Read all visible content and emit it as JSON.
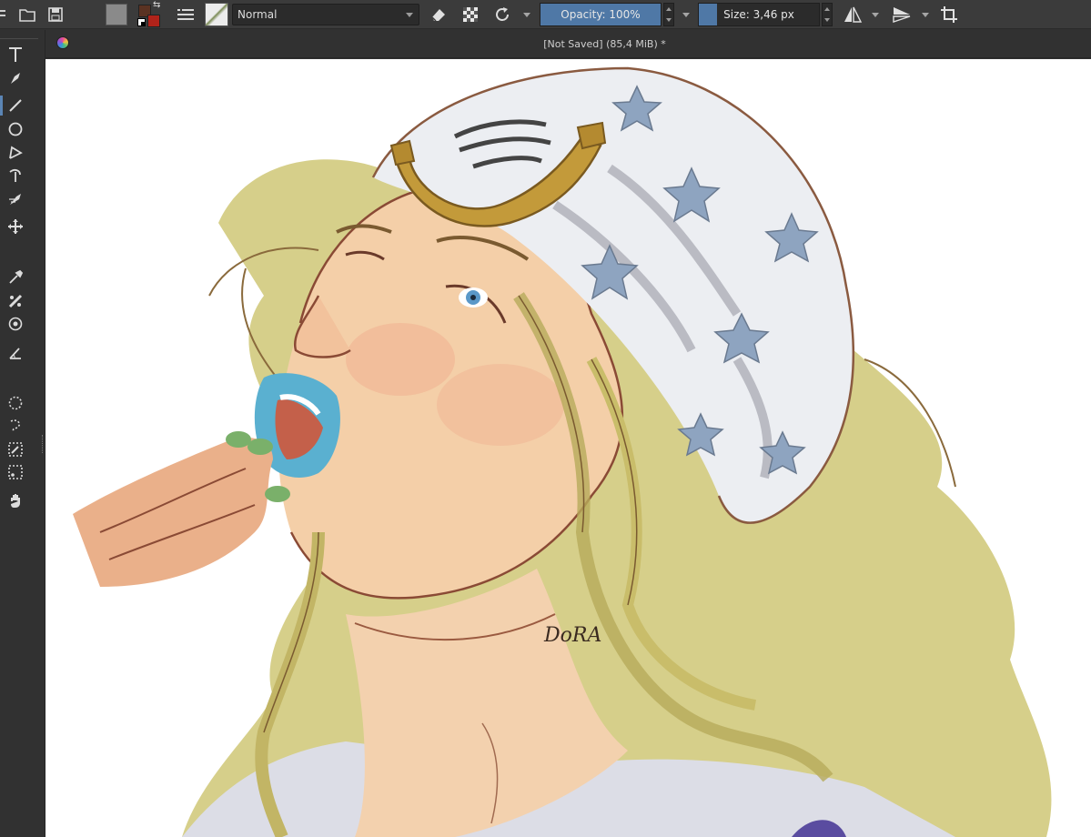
{
  "toolbar": {
    "blend_mode": "Normal",
    "opacity_label": "Opacity: 100%",
    "opacity_fraction": 1.0,
    "size_label": "Size: 3,46 px",
    "icons": [
      "menu-icon",
      "open-folder-icon",
      "save-icon",
      "swap-colors-icon",
      "brush-settings-icon",
      "eraser-icon",
      "alpha-lock-icon",
      "reload-preset-icon",
      "mirror-horizontal-icon",
      "mirror-vertical-icon",
      "crop-icon"
    ],
    "colors": {
      "foreground": "#5a3222",
      "background": "#b0231a",
      "accent": "#4f78a6"
    }
  },
  "document": {
    "title": "[Not Saved]  (85,4 MiB) *"
  },
  "toolbox": {
    "tools": [
      "text-tool",
      "calligraphy-tool",
      "line-tool",
      "ellipse-tool",
      "polyline-tool",
      "bezier-tool",
      "dynamic-brush-tool",
      "move-tool",
      "color-picker-tool",
      "smart-patch-tool",
      "assistant-tool",
      "measure-tool",
      "elliptical-select-tool",
      "freehand-select-tool",
      "similar-select-tool",
      "bezier-select-tool",
      "pan-tool"
    ]
  },
  "canvas": {
    "artwork": "digital painting of a long-haired blond figure with star bandana, horseshoe, blue lips and fingers at mouth",
    "signature": "DoRA"
  }
}
